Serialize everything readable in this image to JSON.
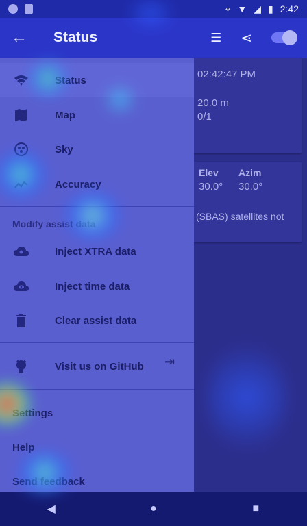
{
  "statusbar": {
    "time": "2:42"
  },
  "appbar": {
    "title": "Status"
  },
  "content": {
    "time": "02:42:47 PM",
    "accuracy": "20.0 m",
    "sats": "0/1",
    "col_elev": "Elev",
    "col_azim": "Azim",
    "elev_val": "30.0°",
    "azim_val": "30.0°",
    "note": "(SBAS) satellites not"
  },
  "drawer": {
    "items": [
      {
        "label": "Status",
        "icon": "wifi-icon"
      },
      {
        "label": "Map",
        "icon": "map-icon"
      },
      {
        "label": "Sky",
        "icon": "sky-icon"
      },
      {
        "label": "Accuracy",
        "icon": "trend-icon"
      }
    ],
    "section": "Modify assist data",
    "assist": [
      {
        "label": "Inject XTRA data",
        "icon": "cloud-gear-icon"
      },
      {
        "label": "Inject time data",
        "icon": "cloud-eye-icon"
      },
      {
        "label": "Clear assist data",
        "icon": "trash-icon"
      }
    ],
    "github": "Visit us on GitHub",
    "settings": "Settings",
    "help": "Help",
    "feedback": "Send feedback"
  },
  "nav": {
    "back": "◀",
    "home": "●",
    "recents": "■"
  }
}
